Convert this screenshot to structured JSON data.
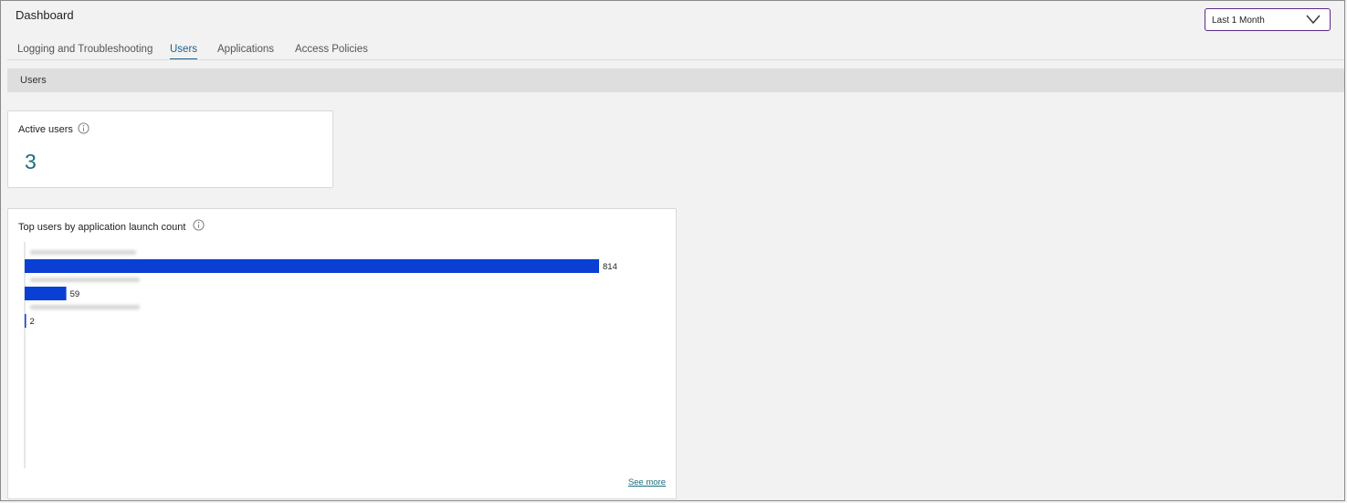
{
  "header": {
    "title": "Dashboard",
    "time_range": "Last 1 Month"
  },
  "tabs": [
    {
      "label": "Logging and Troubleshooting",
      "active": false
    },
    {
      "label": "Users",
      "active": true
    },
    {
      "label": "Applications",
      "active": false
    },
    {
      "label": "Access Policies",
      "active": false
    }
  ],
  "section": {
    "title": "Users"
  },
  "active_users": {
    "label": "Active users",
    "value": "3"
  },
  "top_users": {
    "title": "Top users by application launch count",
    "see_more": "See more"
  },
  "chart_data": {
    "type": "bar",
    "orientation": "horizontal",
    "categories": [
      "",
      "",
      ""
    ],
    "values": [
      814,
      59,
      2
    ],
    "bar_color": "#0a3fd4",
    "grid": false
  },
  "colors": {
    "accent": "#1b6e7c",
    "active_tab": "#1d5f8a",
    "dropdown_border": "#5c2a87",
    "bar": "#0a3fd4"
  }
}
